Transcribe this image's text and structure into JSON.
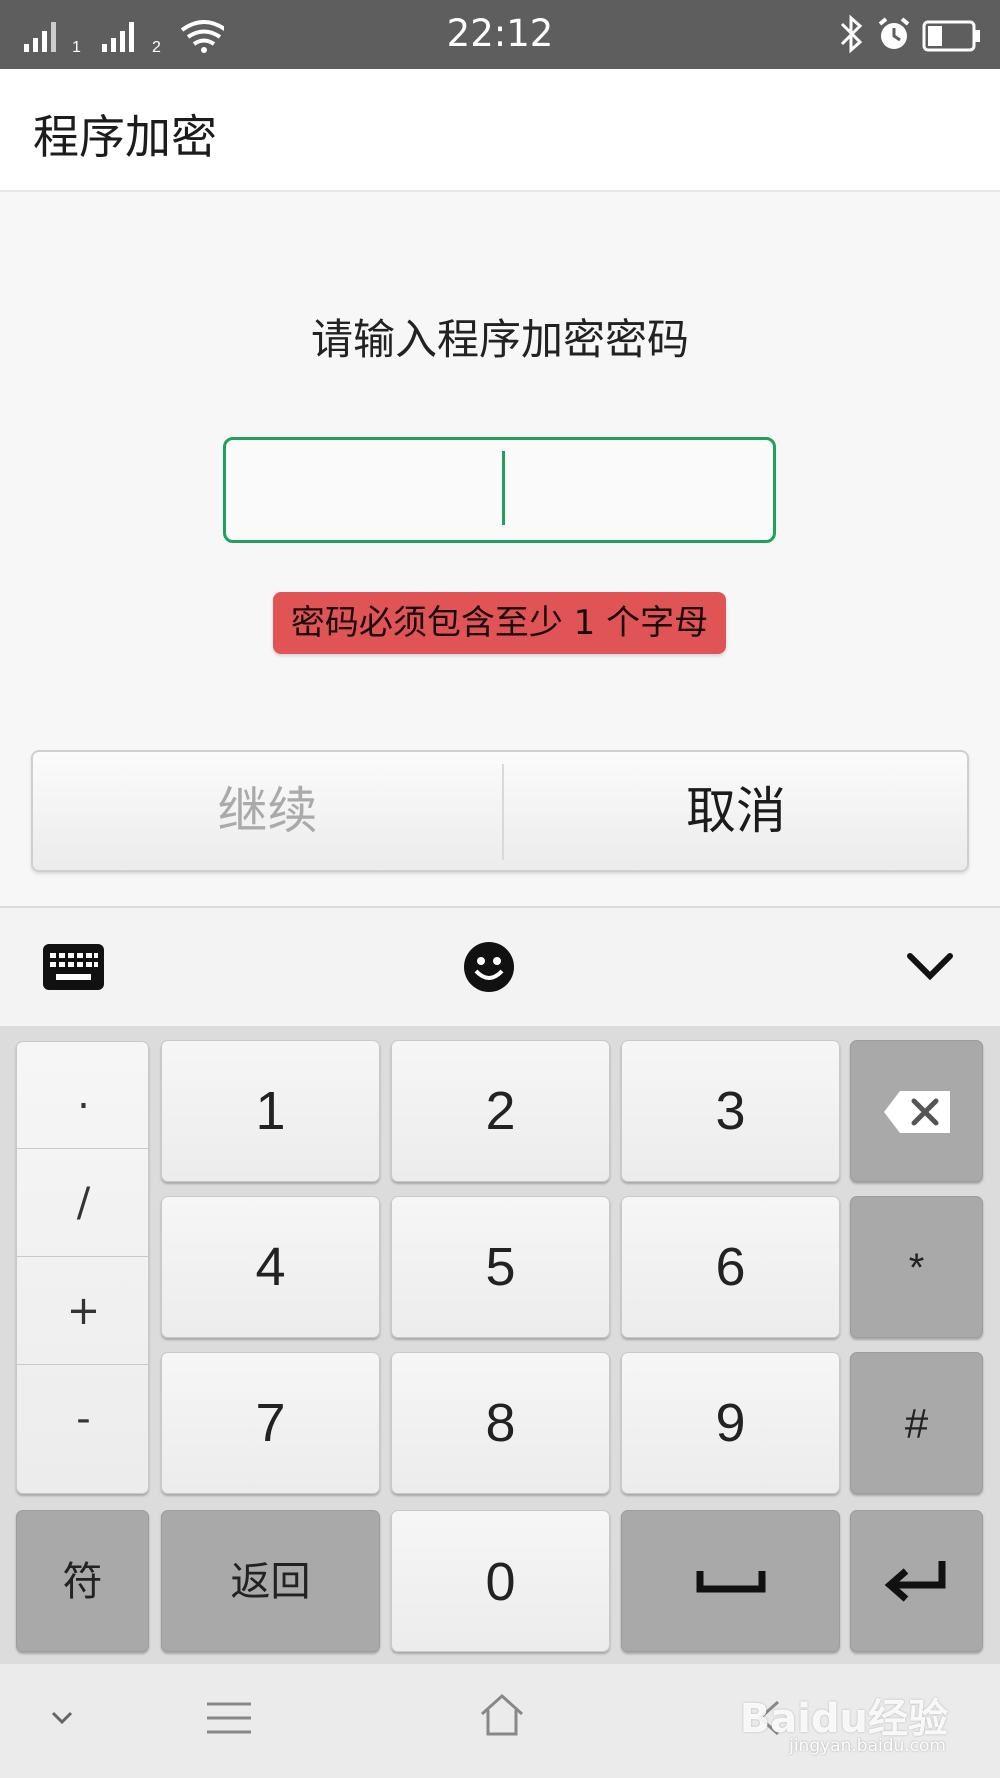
{
  "status_bar": {
    "time": "22:12",
    "sim1_label": "1",
    "sim2_label": "2",
    "icons": [
      "signal-icon",
      "wifi-icon",
      "bluetooth-icon",
      "alarm-icon",
      "battery-icon"
    ]
  },
  "app": {
    "title": "程序加密"
  },
  "content": {
    "prompt": "请输入程序加密密码",
    "password_value": "",
    "error_message": "密码必须包含至少 1 个字母",
    "continue_label": "继续",
    "cancel_label": "取消"
  },
  "keyboard": {
    "toolbar_icons": [
      "keyboard-icon",
      "emoji-icon",
      "collapse-chevron-icon"
    ],
    "symbols": [
      ".",
      "/",
      "+",
      "-"
    ],
    "digits": [
      "1",
      "2",
      "3",
      "4",
      "5",
      "6",
      "7",
      "8",
      "9",
      "0"
    ],
    "star": "*",
    "hash": "#",
    "fu_label": "符",
    "back_label": "返回"
  },
  "watermark": {
    "brand": "Baidu经验",
    "url": "jingyan.baidu.com"
  },
  "colors": {
    "accent_green": "#1ea25a",
    "error_red": "#e05456",
    "status_bar": "#5e5e5e"
  }
}
